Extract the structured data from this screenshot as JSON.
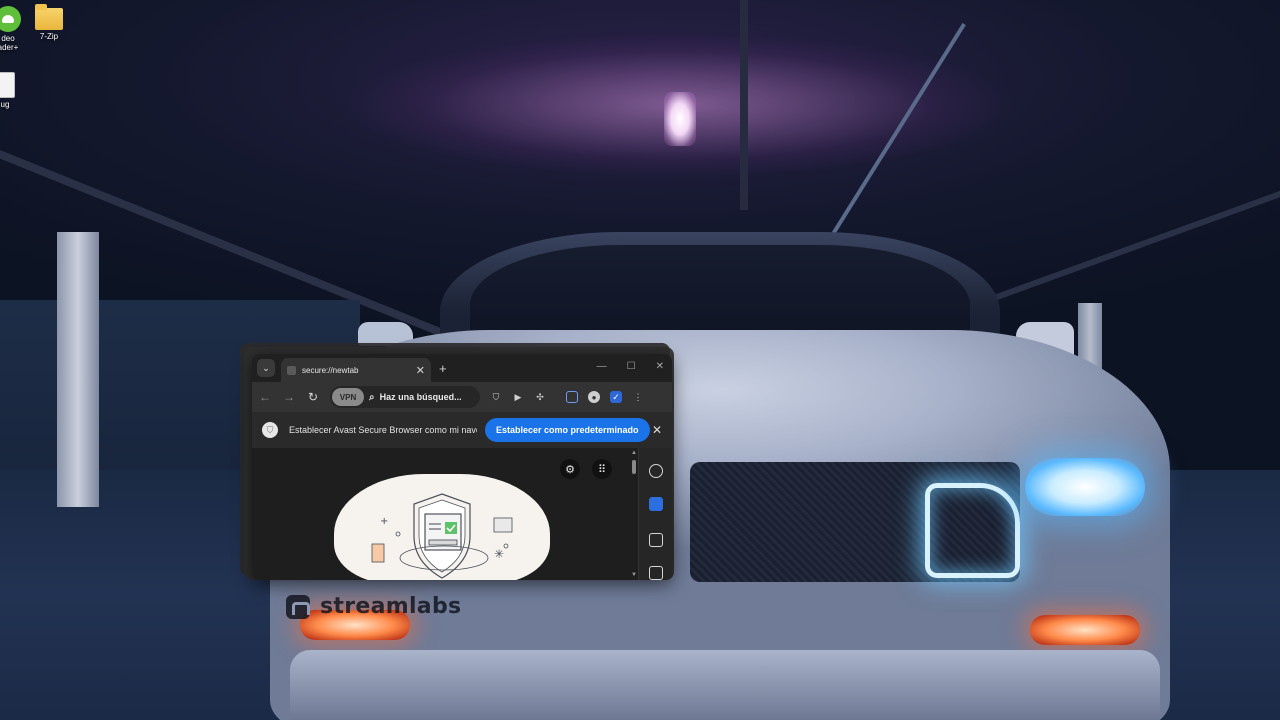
{
  "desktop": {
    "icons": [
      {
        "label": "deo\nader+",
        "icon": "video-downloader-icon"
      },
      {
        "label": "7-Zip",
        "icon": "folder-icon"
      },
      {
        "label": "ug",
        "icon": "file-icon"
      }
    ]
  },
  "watermark": {
    "text": "streamlabs"
  },
  "browser": {
    "tab": {
      "title": "secure://newtab",
      "close_label": "✕"
    },
    "new_tab_label": "+",
    "window_controls": {
      "minimize": "—",
      "maximize": "☐",
      "close": "✕"
    },
    "toolbar": {
      "back": "←",
      "forward": "→",
      "reload": "↻",
      "vpn_label": "VPN",
      "search_label": "Haz una búsqued...",
      "menu": "⋮"
    },
    "infobar": {
      "message": "Establecer Avast Secure Browser como mi nave...",
      "button_label": "Establecer como predeterminado",
      "close_label": "✕"
    },
    "colors": {
      "accent": "#1a73e8",
      "window_bg": "#1f1f1f",
      "toolbar_bg": "#333333"
    }
  }
}
